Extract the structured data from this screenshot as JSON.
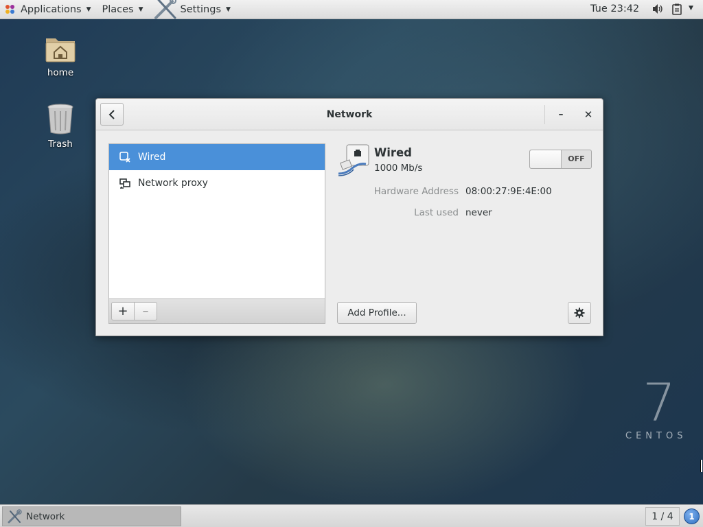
{
  "top_panel": {
    "applications_label": "Applications",
    "places_label": "Places",
    "settings_label": "Settings",
    "clock": "Tue 23:42",
    "icons": [
      "applications-logo-icon",
      "chevron-down-icon",
      "settings-tools-icon",
      "volume-icon",
      "clipboard-icon"
    ]
  },
  "desktop": {
    "icons": [
      {
        "label": "home",
        "icon": "home-folder-icon"
      },
      {
        "label": "Trash",
        "icon": "trash-icon"
      }
    ],
    "watermark": {
      "number": "7",
      "word": "CENTOS"
    }
  },
  "window": {
    "title": "Network",
    "minimize_label": "–",
    "close_label": "✕",
    "devices": [
      {
        "label": "Wired",
        "icon": "wired-device-icon",
        "selected": true
      },
      {
        "label": "Network proxy",
        "icon": "network-proxy-icon",
        "selected": false
      }
    ],
    "add_label": "+",
    "remove_label": "–",
    "detail": {
      "name": "Wired",
      "speed": "1000 Mb/s",
      "toggle_state": "OFF",
      "properties": [
        {
          "label": "Hardware Address",
          "value": "08:00:27:9E:4E:00"
        },
        {
          "label": "Last used",
          "value": "never"
        }
      ],
      "add_profile_label": "Add Profile..."
    },
    "accent_color": "#4a90d9"
  },
  "bottom_panel": {
    "task_label": "Network",
    "workspace": "1 / 4",
    "notification_count": "1"
  }
}
